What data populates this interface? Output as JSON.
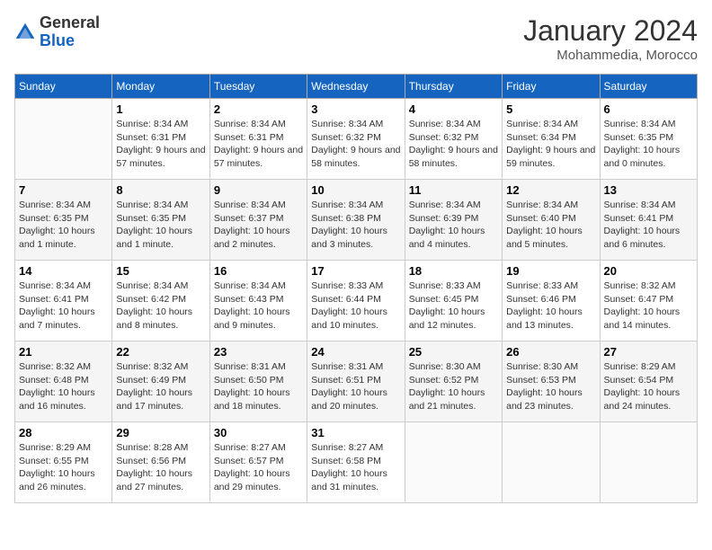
{
  "header": {
    "logo_general": "General",
    "logo_blue": "Blue",
    "month_title": "January 2024",
    "location": "Mohammedia, Morocco"
  },
  "weekdays": [
    "Sunday",
    "Monday",
    "Tuesday",
    "Wednesday",
    "Thursday",
    "Friday",
    "Saturday"
  ],
  "weeks": [
    [
      {
        "day": "",
        "info": ""
      },
      {
        "day": "1",
        "info": "Sunrise: 8:34 AM\nSunset: 6:31 PM\nDaylight: 9 hours and 57 minutes."
      },
      {
        "day": "2",
        "info": "Sunrise: 8:34 AM\nSunset: 6:31 PM\nDaylight: 9 hours and 57 minutes."
      },
      {
        "day": "3",
        "info": "Sunrise: 8:34 AM\nSunset: 6:32 PM\nDaylight: 9 hours and 58 minutes."
      },
      {
        "day": "4",
        "info": "Sunrise: 8:34 AM\nSunset: 6:32 PM\nDaylight: 9 hours and 58 minutes."
      },
      {
        "day": "5",
        "info": "Sunrise: 8:34 AM\nSunset: 6:34 PM\nDaylight: 9 hours and 59 minutes."
      },
      {
        "day": "6",
        "info": "Sunrise: 8:34 AM\nSunset: 6:35 PM\nDaylight: 10 hours and 0 minutes."
      }
    ],
    [
      {
        "day": "7",
        "info": "Sunrise: 8:34 AM\nSunset: 6:35 PM\nDaylight: 10 hours and 1 minute."
      },
      {
        "day": "8",
        "info": "Sunrise: 8:34 AM\nSunset: 6:35 PM\nDaylight: 10 hours and 1 minute."
      },
      {
        "day": "9",
        "info": "Sunrise: 8:34 AM\nSunset: 6:37 PM\nDaylight: 10 hours and 2 minutes."
      },
      {
        "day": "10",
        "info": "Sunrise: 8:34 AM\nSunset: 6:38 PM\nDaylight: 10 hours and 3 minutes."
      },
      {
        "day": "11",
        "info": "Sunrise: 8:34 AM\nSunset: 6:39 PM\nDaylight: 10 hours and 4 minutes."
      },
      {
        "day": "12",
        "info": "Sunrise: 8:34 AM\nSunset: 6:40 PM\nDaylight: 10 hours and 5 minutes."
      },
      {
        "day": "13",
        "info": "Sunrise: 8:34 AM\nSunset: 6:41 PM\nDaylight: 10 hours and 6 minutes."
      }
    ],
    [
      {
        "day": "14",
        "info": "Sunrise: 8:34 AM\nSunset: 6:41 PM\nDaylight: 10 hours and 7 minutes."
      },
      {
        "day": "15",
        "info": "Sunrise: 8:34 AM\nSunset: 6:42 PM\nDaylight: 10 hours and 8 minutes."
      },
      {
        "day": "16",
        "info": "Sunrise: 8:34 AM\nSunset: 6:43 PM\nDaylight: 10 hours and 9 minutes."
      },
      {
        "day": "17",
        "info": "Sunrise: 8:33 AM\nSunset: 6:44 PM\nDaylight: 10 hours and 10 minutes."
      },
      {
        "day": "18",
        "info": "Sunrise: 8:33 AM\nSunset: 6:45 PM\nDaylight: 10 hours and 12 minutes."
      },
      {
        "day": "19",
        "info": "Sunrise: 8:33 AM\nSunset: 6:46 PM\nDaylight: 10 hours and 13 minutes."
      },
      {
        "day": "20",
        "info": "Sunrise: 8:32 AM\nSunset: 6:47 PM\nDaylight: 10 hours and 14 minutes."
      }
    ],
    [
      {
        "day": "21",
        "info": "Sunrise: 8:32 AM\nSunset: 6:48 PM\nDaylight: 10 hours and 16 minutes."
      },
      {
        "day": "22",
        "info": "Sunrise: 8:32 AM\nSunset: 6:49 PM\nDaylight: 10 hours and 17 minutes."
      },
      {
        "day": "23",
        "info": "Sunrise: 8:31 AM\nSunset: 6:50 PM\nDaylight: 10 hours and 18 minutes."
      },
      {
        "day": "24",
        "info": "Sunrise: 8:31 AM\nSunset: 6:51 PM\nDaylight: 10 hours and 20 minutes."
      },
      {
        "day": "25",
        "info": "Sunrise: 8:30 AM\nSunset: 6:52 PM\nDaylight: 10 hours and 21 minutes."
      },
      {
        "day": "26",
        "info": "Sunrise: 8:30 AM\nSunset: 6:53 PM\nDaylight: 10 hours and 23 minutes."
      },
      {
        "day": "27",
        "info": "Sunrise: 8:29 AM\nSunset: 6:54 PM\nDaylight: 10 hours and 24 minutes."
      }
    ],
    [
      {
        "day": "28",
        "info": "Sunrise: 8:29 AM\nSunset: 6:55 PM\nDaylight: 10 hours and 26 minutes."
      },
      {
        "day": "29",
        "info": "Sunrise: 8:28 AM\nSunset: 6:56 PM\nDaylight: 10 hours and 27 minutes."
      },
      {
        "day": "30",
        "info": "Sunrise: 8:27 AM\nSunset: 6:57 PM\nDaylight: 10 hours and 29 minutes."
      },
      {
        "day": "31",
        "info": "Sunrise: 8:27 AM\nSunset: 6:58 PM\nDaylight: 10 hours and 31 minutes."
      },
      {
        "day": "",
        "info": ""
      },
      {
        "day": "",
        "info": ""
      },
      {
        "day": "",
        "info": ""
      }
    ]
  ]
}
